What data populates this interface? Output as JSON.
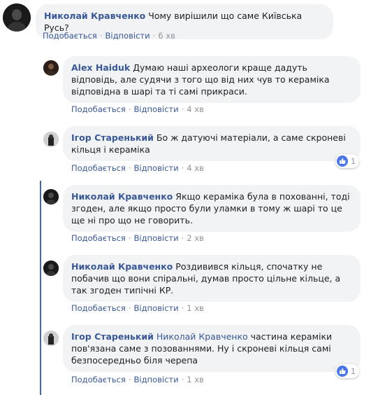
{
  "actions": {
    "like": "Подобається",
    "reply": "Відповісти"
  },
  "comments": [
    {
      "author": "Николай Кравченко",
      "text": "Чому вирішили що саме Київська Русь?",
      "time": "6 хв"
    },
    {
      "author": "Alex Haiduk",
      "text": "Думаю наші археологи краще дадуть відповідь, але судячи з того що від них чув то кераміка відповідна в шарі та ті самі прикраси.",
      "time": "4 хв"
    },
    {
      "author": "Ігор Старенький",
      "text": "Бо ж датуючі матеріали, а саме скроневі кільця і кераміка",
      "time": "4 хв",
      "reactions": "1"
    },
    {
      "author": "Николай Кравченко",
      "text": "Якщо кераміка була в похованні, тоді згоден, але якщо просто були уламки в тому ж шарі то це ще ні про що не говорить.",
      "time": "2 хв"
    },
    {
      "author": "Николай Кравченко",
      "text": "Роздивився кільця, спочатку не побачив що вони спіральні, думав просто цільне кільце, а так згоден типічні КР.",
      "time": "1 хв"
    },
    {
      "author": "Ігор Старенький",
      "mention": "Николай Кравченко",
      "text": "частина кераміки пов'язана саме з позованнями. Ну і скроневі кільця самі безпосередньо біля черепа",
      "time": "1 хв",
      "reactions": "1"
    }
  ]
}
